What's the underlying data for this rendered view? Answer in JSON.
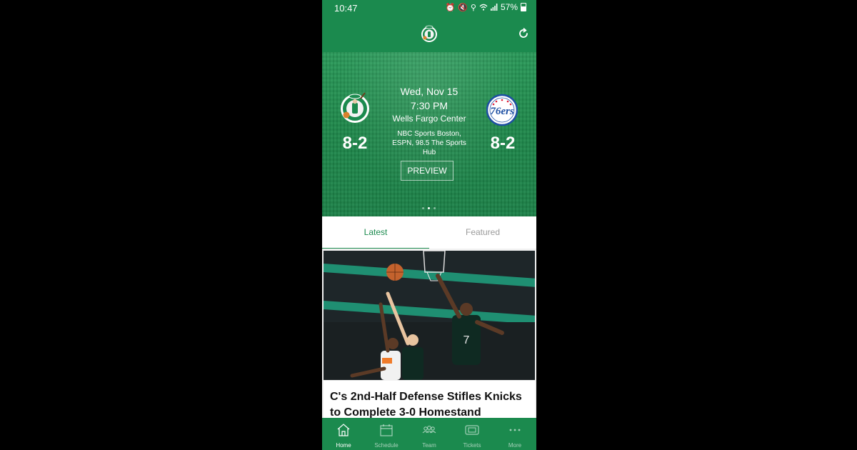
{
  "status_bar": {
    "time": "10:47",
    "battery_pct": "57%"
  },
  "app": {
    "logo_icon": "celtics-logo-icon",
    "refresh_icon": "refresh-icon"
  },
  "game": {
    "date": "Wed, Nov 15",
    "time": "7:30 PM",
    "venue": "Wells Fargo Center",
    "broadcast": "NBC Sports Boston, ESPN, 98.5 The Sports Hub",
    "home_team": {
      "logo": "celtics-logo-icon",
      "record": "8-2"
    },
    "away_team": {
      "logo": "76ers-logo-icon",
      "record": "8-2"
    },
    "preview_label": "PREVIEW",
    "carousel": {
      "count": 3,
      "active": 2
    }
  },
  "tabs": [
    {
      "label": "Latest",
      "active": true
    },
    {
      "label": "Featured",
      "active": false
    }
  ],
  "article": {
    "headline": "C's 2nd-Half Defense Stifles Knicks to Complete 3-0 Homestand"
  },
  "bottom_nav": [
    {
      "label": "Home",
      "icon": "home-icon",
      "active": true
    },
    {
      "label": "Schedule",
      "icon": "calendar-icon",
      "active": false
    },
    {
      "label": "Team",
      "icon": "team-icon",
      "active": false
    },
    {
      "label": "Tickets",
      "icon": "ticket-icon",
      "active": false
    },
    {
      "label": "More",
      "icon": "more-icon",
      "active": false
    }
  ],
  "colors": {
    "brand_green": "#1b8a4e",
    "sixers_blue": "#1d4fa3",
    "sixers_red": "#e01e38"
  }
}
